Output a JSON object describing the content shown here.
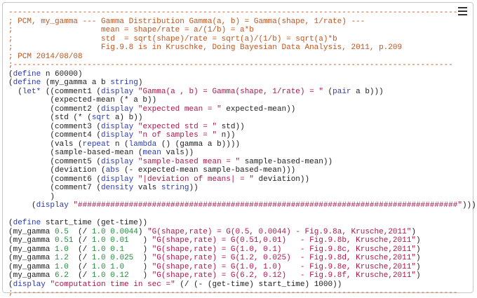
{
  "editor": {
    "menu_icon": "hamburger-menu-icon",
    "colors": {
      "comment": "#c4531a",
      "keyword": "#2c3ab4",
      "string": "#b1154a",
      "number": "#248d3c",
      "plain": "#1c1c1c"
    },
    "lines": [
      [
        [
          "c",
          "-------------------------------------------------------------------------------------------------"
        ]
      ],
      [
        [
          "c",
          "; PCM, my_gamma --- Gamma Distribution Gamma(a, b) = Gamma(shape, 1/rate) ---"
        ]
      ],
      [
        [
          "c",
          ";                   mean = shape/rate = a/(1/b) = a*b"
        ]
      ],
      [
        [
          "c",
          ";                   std  = sqrt(shape)/rate = sqrt(a)/(1/b) = sqrt(a)*b"
        ]
      ],
      [
        [
          "c",
          ";                   Fig.9.8 is in Kruschke, Doing Bayesian Data Analysis, 2011, p.209"
        ]
      ],
      [
        [
          "c",
          "; PCM 2014/08/08"
        ]
      ],
      [
        [
          "c",
          ";-----------------------------------------------------------------------------------------------"
        ]
      ],
      [
        [
          "p",
          "("
        ],
        [
          "k",
          "define"
        ],
        [
          "p",
          " n 60000)"
        ]
      ],
      [
        [
          "p",
          "("
        ],
        [
          "k",
          "define"
        ],
        [
          "p",
          " (my_gamma a b "
        ],
        [
          "k",
          "string"
        ],
        [
          "p",
          ")"
        ]
      ],
      [
        [
          "p",
          "  ("
        ],
        [
          "k",
          "let*"
        ],
        [
          "p",
          " ((comment1 ("
        ],
        [
          "k",
          "display"
        ],
        [
          "p",
          " "
        ],
        [
          "s",
          "\"Gamma(a , b) = Gamma(shape, 1/rate) = \""
        ],
        [
          "p",
          " ("
        ],
        [
          "k",
          "pair"
        ],
        [
          "p",
          " a b)))"
        ]
      ],
      [
        [
          "p",
          "         (expected-mean (* a b))"
        ]
      ],
      [
        [
          "p",
          "         (comment2 ("
        ],
        [
          "k",
          "display"
        ],
        [
          "p",
          " "
        ],
        [
          "s",
          "\"expected mean = \""
        ],
        [
          "p",
          " expected-mean))"
        ]
      ],
      [
        [
          "p",
          "         (std (* ("
        ],
        [
          "k",
          "sqrt"
        ],
        [
          "p",
          " a) b))"
        ]
      ],
      [
        [
          "p",
          "         (comment3 ("
        ],
        [
          "k",
          "display"
        ],
        [
          "p",
          " "
        ],
        [
          "s",
          "\"expected std = \""
        ],
        [
          "p",
          " std))"
        ]
      ],
      [
        [
          "p",
          "         (comment4 ("
        ],
        [
          "k",
          "display"
        ],
        [
          "p",
          " "
        ],
        [
          "s",
          "\"n of samples = \""
        ],
        [
          "p",
          " n))"
        ]
      ],
      [
        [
          "p",
          "         (vals ("
        ],
        [
          "k",
          "repeat"
        ],
        [
          "p",
          " n ("
        ],
        [
          "k",
          "lambda"
        ],
        [
          "p",
          " () (gamma a b))))"
        ]
      ],
      [
        [
          "p",
          "         (sample-based-mean ("
        ],
        [
          "k",
          "mean"
        ],
        [
          "p",
          " vals))"
        ]
      ],
      [
        [
          "p",
          "         (comment5 ("
        ],
        [
          "k",
          "display"
        ],
        [
          "p",
          " "
        ],
        [
          "s",
          "\"sample-based mean = \""
        ],
        [
          "p",
          " sample-based-mean))"
        ]
      ],
      [
        [
          "p",
          "         (deviation ("
        ],
        [
          "k",
          "abs"
        ],
        [
          "p",
          " (- expected-mean sample-based-mean)))"
        ]
      ],
      [
        [
          "p",
          "         (comment6 ("
        ],
        [
          "k",
          "display"
        ],
        [
          "p",
          " "
        ],
        [
          "s",
          "\"|deviation of means| = \""
        ],
        [
          "p",
          " deviation))"
        ]
      ],
      [
        [
          "p",
          "         (comment7 ("
        ],
        [
          "k",
          "density"
        ],
        [
          "p",
          " vals "
        ],
        [
          "k",
          "string"
        ],
        [
          "p",
          "))"
        ]
      ],
      [
        [
          "p",
          "         )"
        ]
      ],
      [
        [
          "p",
          "     ("
        ],
        [
          "k",
          "display"
        ],
        [
          "p",
          " "
        ],
        [
          "s",
          "\"##################################################################################\""
        ],
        [
          "p",
          ")))"
        ]
      ],
      [
        [
          "p",
          ""
        ]
      ],
      [
        [
          "p",
          "("
        ],
        [
          "k",
          "define"
        ],
        [
          "p",
          " start_time (get-time))"
        ]
      ],
      [
        [
          "p",
          "(my_gamma "
        ],
        [
          "n",
          "0.5"
        ],
        [
          "p",
          "  (/ "
        ],
        [
          "n",
          "1.0"
        ],
        [
          "p",
          " "
        ],
        [
          "n",
          "0.0044"
        ],
        [
          "p",
          ") "
        ],
        [
          "s",
          "\"G(shape,rate) = G(0.5, 0.0044) - Fig.9.8a, Krusche,2011\""
        ],
        [
          "p",
          ")"
        ]
      ],
      [
        [
          "p",
          "(my_gamma "
        ],
        [
          "n",
          "0.51"
        ],
        [
          "p",
          " (/ "
        ],
        [
          "n",
          "1.0"
        ],
        [
          "p",
          " "
        ],
        [
          "n",
          "0.01"
        ],
        [
          "p",
          "   ) "
        ],
        [
          "s",
          "\"G(shape,rate) = G(0.51,0.01)   - Fig.9.8b, Krusche,2011\""
        ],
        [
          "p",
          ")"
        ]
      ],
      [
        [
          "p",
          "(my_gamma "
        ],
        [
          "n",
          "1.0"
        ],
        [
          "p",
          "  (/ "
        ],
        [
          "n",
          "1.0"
        ],
        [
          "p",
          " "
        ],
        [
          "n",
          "0.1"
        ],
        [
          "p",
          "    ) "
        ],
        [
          "s",
          "\"G(shape,rate) = G(1.0, 0.1)    - Fig.9.8c, Krusche,2011\""
        ],
        [
          "p",
          ")"
        ]
      ],
      [
        [
          "p",
          "(my_gamma "
        ],
        [
          "n",
          "1.2"
        ],
        [
          "p",
          "  (/ "
        ],
        [
          "n",
          "1.0"
        ],
        [
          "p",
          " "
        ],
        [
          "n",
          "0.025"
        ],
        [
          "p",
          "  ) "
        ],
        [
          "s",
          "\"G(shape,rate) = G(1.2, 0.025)  - Fig.9.8d, Krusche,2011\""
        ],
        [
          "p",
          ")"
        ]
      ],
      [
        [
          "p",
          "(my_gamma "
        ],
        [
          "n",
          "1.0"
        ],
        [
          "p",
          "  (/ "
        ],
        [
          "n",
          "1.0"
        ],
        [
          "p",
          " "
        ],
        [
          "n",
          "1.0"
        ],
        [
          "p",
          "    ) "
        ],
        [
          "s",
          "\"G(shape,rate) = G(1.0, 1.0)    - Fig.9.8e, Krusche,2011\""
        ],
        [
          "p",
          ")"
        ]
      ],
      [
        [
          "p",
          "(my_gamma "
        ],
        [
          "n",
          "6.2"
        ],
        [
          "p",
          "  (/ "
        ],
        [
          "n",
          "1.0"
        ],
        [
          "p",
          " "
        ],
        [
          "n",
          "0.12"
        ],
        [
          "p",
          "   ) "
        ],
        [
          "s",
          "\"G(shape,rate) = G(6.2, 0.12)   - Fig.9.8f, Krusche,2011\""
        ],
        [
          "p",
          ")"
        ]
      ],
      [
        [
          "p",
          "("
        ],
        [
          "k",
          "display"
        ],
        [
          "p",
          " "
        ],
        [
          "s",
          "\"computation time in sec =\""
        ],
        [
          "p",
          " (/ (- (get-time) start_time) 1000))"
        ]
      ],
      [
        [
          "c",
          ";------------------------------------------------------------------------------------------------"
        ]
      ]
    ]
  }
}
